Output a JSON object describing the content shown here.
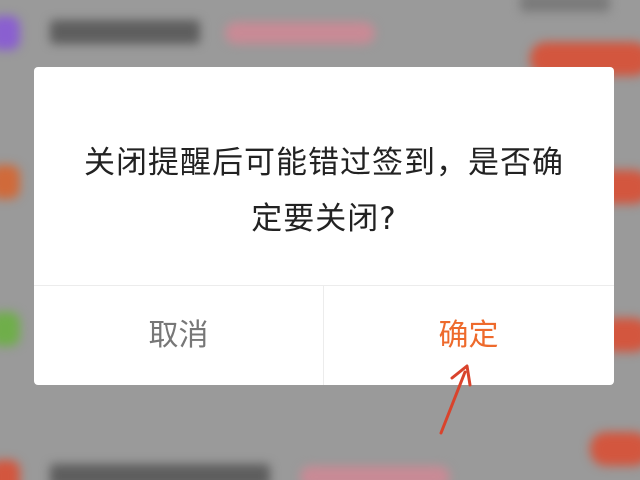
{
  "dialog": {
    "message": "关闭提醒后可能错过签到，是否确定要关闭?",
    "cancel_label": "取消",
    "confirm_label": "确定"
  },
  "colors": {
    "confirm_accent": "#ee6a2c",
    "cancel_text": "#777777",
    "annotation_arrow": "#d9432c",
    "overlay": "#9a9a9a"
  },
  "icons": {
    "annotation": "arrow-up-icon"
  }
}
